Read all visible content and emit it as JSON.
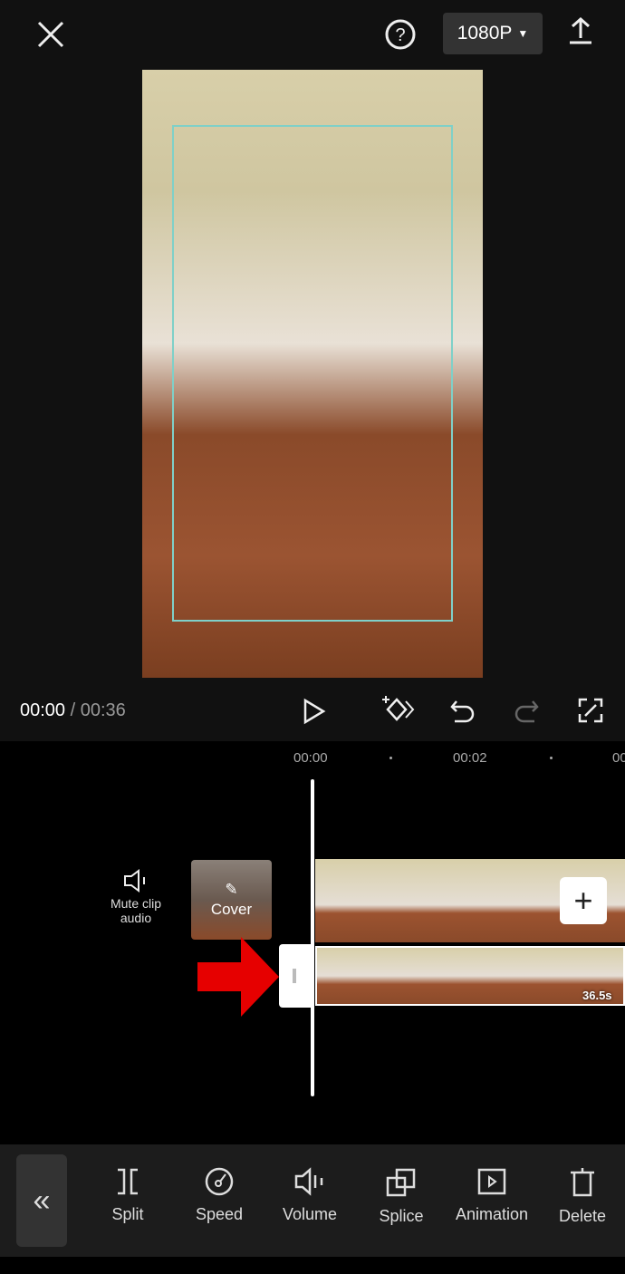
{
  "header": {
    "resolution": "1080P"
  },
  "player": {
    "current_time": "00:00",
    "separator": " / ",
    "duration": "00:36"
  },
  "timeline": {
    "ticks": [
      "00:00",
      "00:02",
      "00"
    ],
    "mute_label": "Mute clip audio",
    "cover_label": "Cover",
    "clip_duration": "36.5s"
  },
  "toolbar": {
    "items": [
      {
        "label": "Split",
        "icon": "split-icon"
      },
      {
        "label": "Speed",
        "icon": "speed-icon"
      },
      {
        "label": "Volume",
        "icon": "volume-icon"
      },
      {
        "label": "Splice",
        "icon": "splice-icon"
      },
      {
        "label": "Animation",
        "icon": "animation-icon"
      },
      {
        "label": "Delete",
        "icon": "delete-icon"
      }
    ]
  },
  "colors": {
    "annotation_arrow": "#e60000",
    "frame": "#7fd0c8"
  }
}
